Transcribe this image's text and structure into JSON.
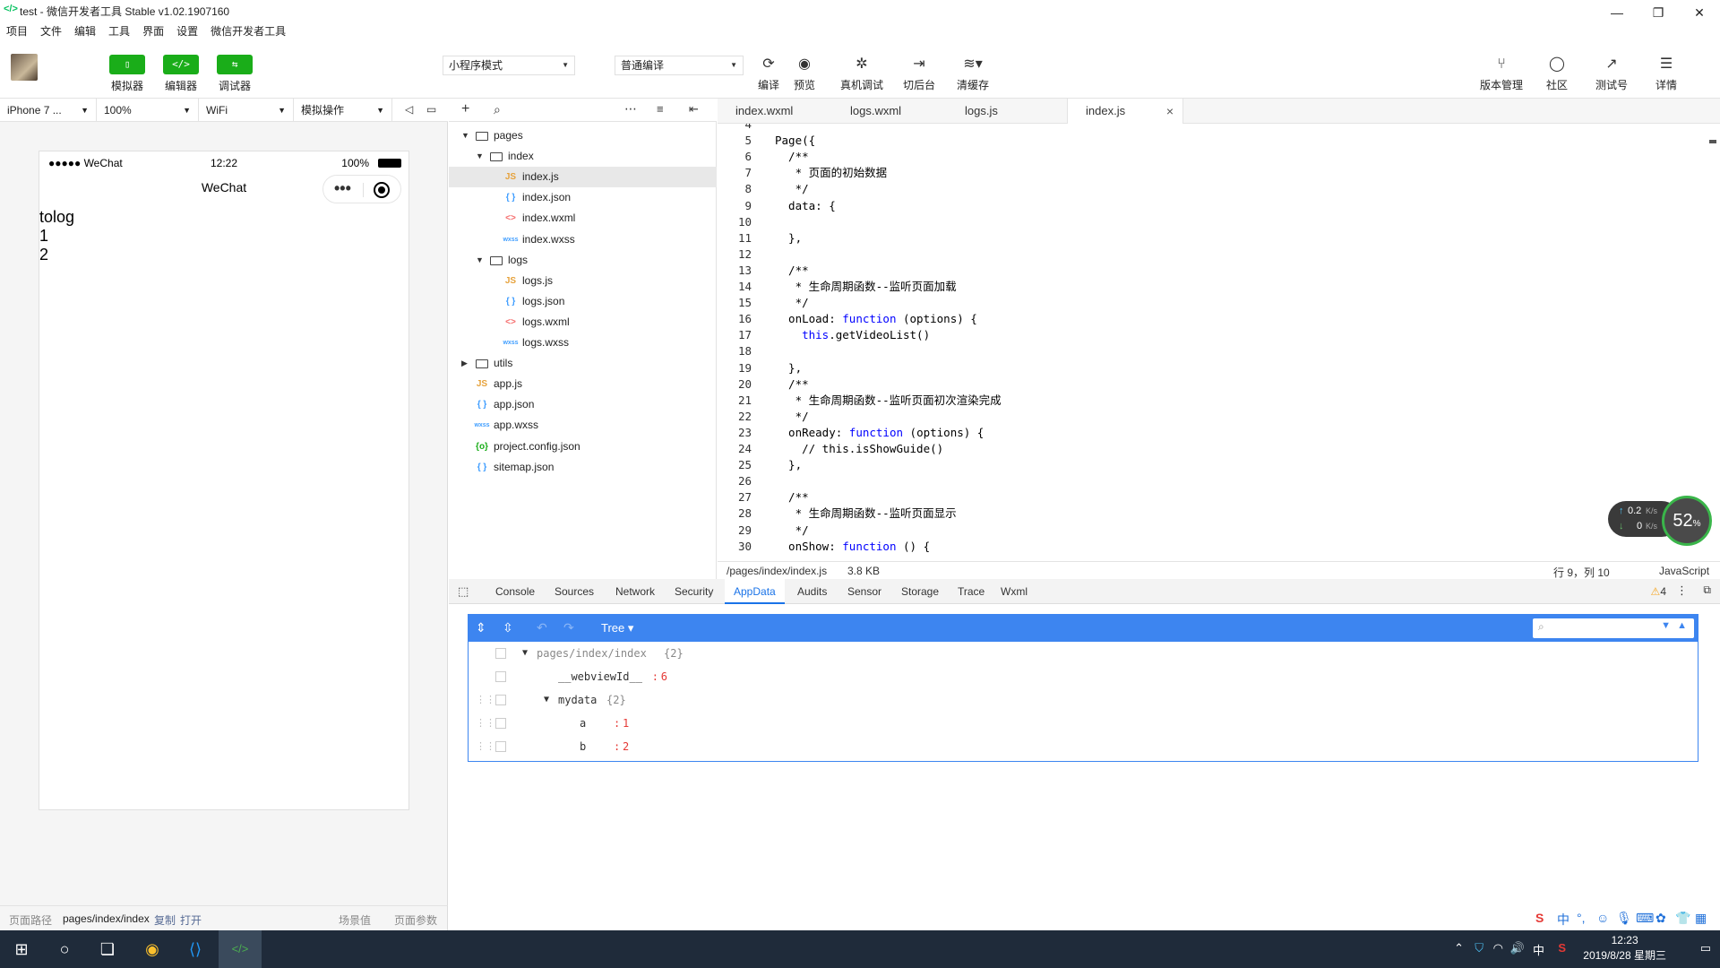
{
  "window": {
    "title": "test - 微信开发者工具 Stable v1.02.1907160",
    "app_icon": "</>",
    "minimize": "—",
    "restore": "❐",
    "close": "✕"
  },
  "menu": [
    "项目",
    "文件",
    "编辑",
    "工具",
    "界面",
    "设置",
    "微信开发者工具"
  ],
  "toolbar": {
    "simulator": "模拟器",
    "editor": "编辑器",
    "debugger": "调试器",
    "mode_select": "小程序模式",
    "compile_select": "普通编译",
    "compile": "编译",
    "preview": "预览",
    "remote_debug": "真机调试",
    "background": "切后台",
    "clear_cache": "清缓存",
    "version": "版本管理",
    "community": "社区",
    "test_account": "测试号",
    "details": "详情"
  },
  "sim_header": {
    "device": "iPhone 7 ...",
    "zoom": "100%",
    "network": "WiFi",
    "operation": "模拟操作"
  },
  "phone": {
    "carrier": "●●●●● WeChat",
    "time": "12:22",
    "battery": "100%",
    "nav_title": "WeChat",
    "content": [
      "tolog",
      "1",
      "2"
    ]
  },
  "bottom_bar": {
    "path_label": "页面路径",
    "path": "pages/index/index",
    "copy": "复制",
    "open": "打开",
    "scene": "场景值",
    "params": "页面参数"
  },
  "tree": [
    {
      "label": "pages",
      "type": "folder",
      "depth": 0,
      "open": true
    },
    {
      "label": "index",
      "type": "folder",
      "depth": 1,
      "open": true
    },
    {
      "label": "index.js",
      "type": "js",
      "depth": 2,
      "active": true
    },
    {
      "label": "index.json",
      "type": "json",
      "depth": 2
    },
    {
      "label": "index.wxml",
      "type": "wxml",
      "depth": 2
    },
    {
      "label": "index.wxss",
      "type": "wxss",
      "depth": 2
    },
    {
      "label": "logs",
      "type": "folder",
      "depth": 1,
      "open": true
    },
    {
      "label": "logs.js",
      "type": "js",
      "depth": 2
    },
    {
      "label": "logs.json",
      "type": "json",
      "depth": 2
    },
    {
      "label": "logs.wxml",
      "type": "wxml",
      "depth": 2
    },
    {
      "label": "logs.wxss",
      "type": "wxss",
      "depth": 2
    },
    {
      "label": "utils",
      "type": "folder",
      "depth": 0,
      "open": false
    },
    {
      "label": "app.js",
      "type": "js",
      "depth": 0
    },
    {
      "label": "app.json",
      "type": "json",
      "depth": 0
    },
    {
      "label": "app.wxss",
      "type": "wxss",
      "depth": 0
    },
    {
      "label": "project.config.json",
      "type": "config",
      "depth": 0
    },
    {
      "label": "sitemap.json",
      "type": "json",
      "depth": 0
    }
  ],
  "tabs": [
    {
      "label": "index.wxml"
    },
    {
      "label": "logs.wxml"
    },
    {
      "label": "logs.js"
    },
    {
      "label": "index.js",
      "active": true
    }
  ],
  "code": [
    {
      "n": "4",
      "t": ""
    },
    {
      "n": "5",
      "t": "Page({"
    },
    {
      "n": "6",
      "t": "  /**",
      "c": "cm"
    },
    {
      "n": "7",
      "t": "   * 页面的初始数据",
      "c": "cm"
    },
    {
      "n": "8",
      "t": "   */",
      "c": "cm"
    },
    {
      "n": "9",
      "t": "  data: {"
    },
    {
      "n": "10",
      "t": ""
    },
    {
      "n": "11",
      "t": "  },"
    },
    {
      "n": "12",
      "t": ""
    },
    {
      "n": "13",
      "t": "  /**",
      "c": "cm"
    },
    {
      "n": "14",
      "t": "   * 生命周期函数--监听页面加载",
      "c": "cm"
    },
    {
      "n": "15",
      "t": "   */",
      "c": "cm"
    },
    {
      "n": "16",
      "t": "  onLoad: function (options) {",
      "kw": "function"
    },
    {
      "n": "17",
      "t": "    this.getVideoList()",
      "kw": "this"
    },
    {
      "n": "18",
      "t": ""
    },
    {
      "n": "19",
      "t": "  },"
    },
    {
      "n": "20",
      "t": "  /**",
      "c": "cm"
    },
    {
      "n": "21",
      "t": "   * 生命周期函数--监听页面初次渲染完成",
      "c": "cm"
    },
    {
      "n": "22",
      "t": "   */",
      "c": "cm"
    },
    {
      "n": "23",
      "t": "  onReady: function (options) {",
      "kw": "function"
    },
    {
      "n": "24",
      "t": "    // this.isShowGuide()",
      "c": "cm"
    },
    {
      "n": "25",
      "t": "  },"
    },
    {
      "n": "26",
      "t": ""
    },
    {
      "n": "27",
      "t": "  /**",
      "c": "cm"
    },
    {
      "n": "28",
      "t": "   * 生命周期函数--监听页面显示",
      "c": "cm"
    },
    {
      "n": "29",
      "t": "   */",
      "c": "cm"
    },
    {
      "n": "30",
      "t": "  onShow: function () {",
      "kw": "function"
    }
  ],
  "editor_status": {
    "path": "/pages/index/index.js",
    "size": "3.8 KB",
    "position": "行 9，列 10",
    "lang": "JavaScript"
  },
  "speed": {
    "up": "0.2",
    "down": "0",
    "unit": "K/s",
    "percent": "52"
  },
  "devtools_tabs": [
    "Console",
    "Sources",
    "Network",
    "Security",
    "AppData",
    "Audits",
    "Sensor",
    "Storage",
    "Trace",
    "Wxml"
  ],
  "devtools_active": "AppData",
  "warnings": "4",
  "appdata": {
    "view_mode": "Tree",
    "rows": [
      {
        "key": "pages/index/index",
        "meta": "{2}",
        "indent": 0,
        "toggle": "▼",
        "gray": true
      },
      {
        "key": "__webviewId__",
        "value": "6",
        "indent": 1
      },
      {
        "key": "mydata",
        "meta": "{2}",
        "indent": 1,
        "toggle": "▼"
      },
      {
        "key": "a",
        "value": "1",
        "indent": 2
      },
      {
        "key": "b",
        "value": "2",
        "indent": 2
      }
    ]
  },
  "taskbar": {
    "time": "12:23",
    "date": "2019/8/28 星期三",
    "ime": "中"
  }
}
